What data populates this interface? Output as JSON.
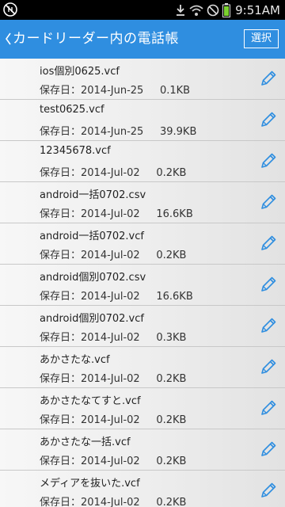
{
  "status_bar": {
    "time": "9:51AM"
  },
  "header": {
    "back_icon": "chevron-left-icon",
    "title": "カードリーダー内の電話帳",
    "select_label": "選択"
  },
  "files": [
    {
      "name": "ios個別0625.vcf",
      "meta": "保存日：2014-Jun-25     0.1KB"
    },
    {
      "name": "test0625.vcf",
      "meta": "保存日：2014-Jun-25     39.9KB"
    },
    {
      "name": "12345678.vcf",
      "meta": "保存日：2014-Jul-02     0.2KB"
    },
    {
      "name": "android一括0702.csv",
      "meta": "保存日：2014-Jul-02     16.6KB"
    },
    {
      "name": "android一括0702.vcf",
      "meta": "保存日：2014-Jul-02     0.2KB"
    },
    {
      "name": "android個別0702.csv",
      "meta": "保存日：2014-Jul-02     16.6KB"
    },
    {
      "name": "android個別0702.vcf",
      "meta": "保存日：2014-Jul-02     0.3KB"
    },
    {
      "name": "あかさたな.vcf",
      "meta": "保存日：2014-Jul-02     0.2KB"
    },
    {
      "name": "あかさたなてすと.vcf",
      "meta": "保存日：2014-Jul-02     0.2KB"
    },
    {
      "name": "あかさたな一括.vcf",
      "meta": "保存日：2014-Jul-02     0.2KB"
    },
    {
      "name": "メディアを抜いた.vcf",
      "meta": "保存日：2014-Jul-02     0.2KB"
    }
  ],
  "colors": {
    "accent": "#2f8ee0",
    "edit_icon": "#2f8ee0"
  }
}
